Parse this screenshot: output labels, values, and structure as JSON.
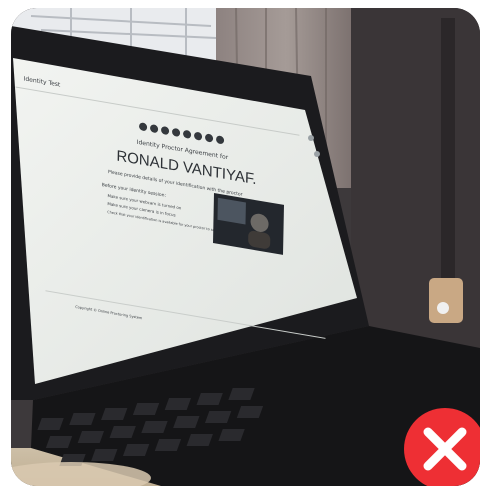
{
  "photo": {
    "screen": {
      "tab_label": "Identity Test",
      "welcome_line": "Identity Proctor Agreement for",
      "candidate_name": "RONALD VANTIYAF.",
      "notice": "Please provide details of your identification with the proctor",
      "list_heading": "Before your identity session:",
      "list_items": [
        "Make sure your webcam is turned on",
        "Make sure your camera is in focus",
        "Check that your identification is available for your proctor to see"
      ],
      "footer": "Copyright © Online Proctoring System"
    },
    "reject_badge": {
      "icon": "close-icon",
      "color": "#ee2f34"
    }
  }
}
